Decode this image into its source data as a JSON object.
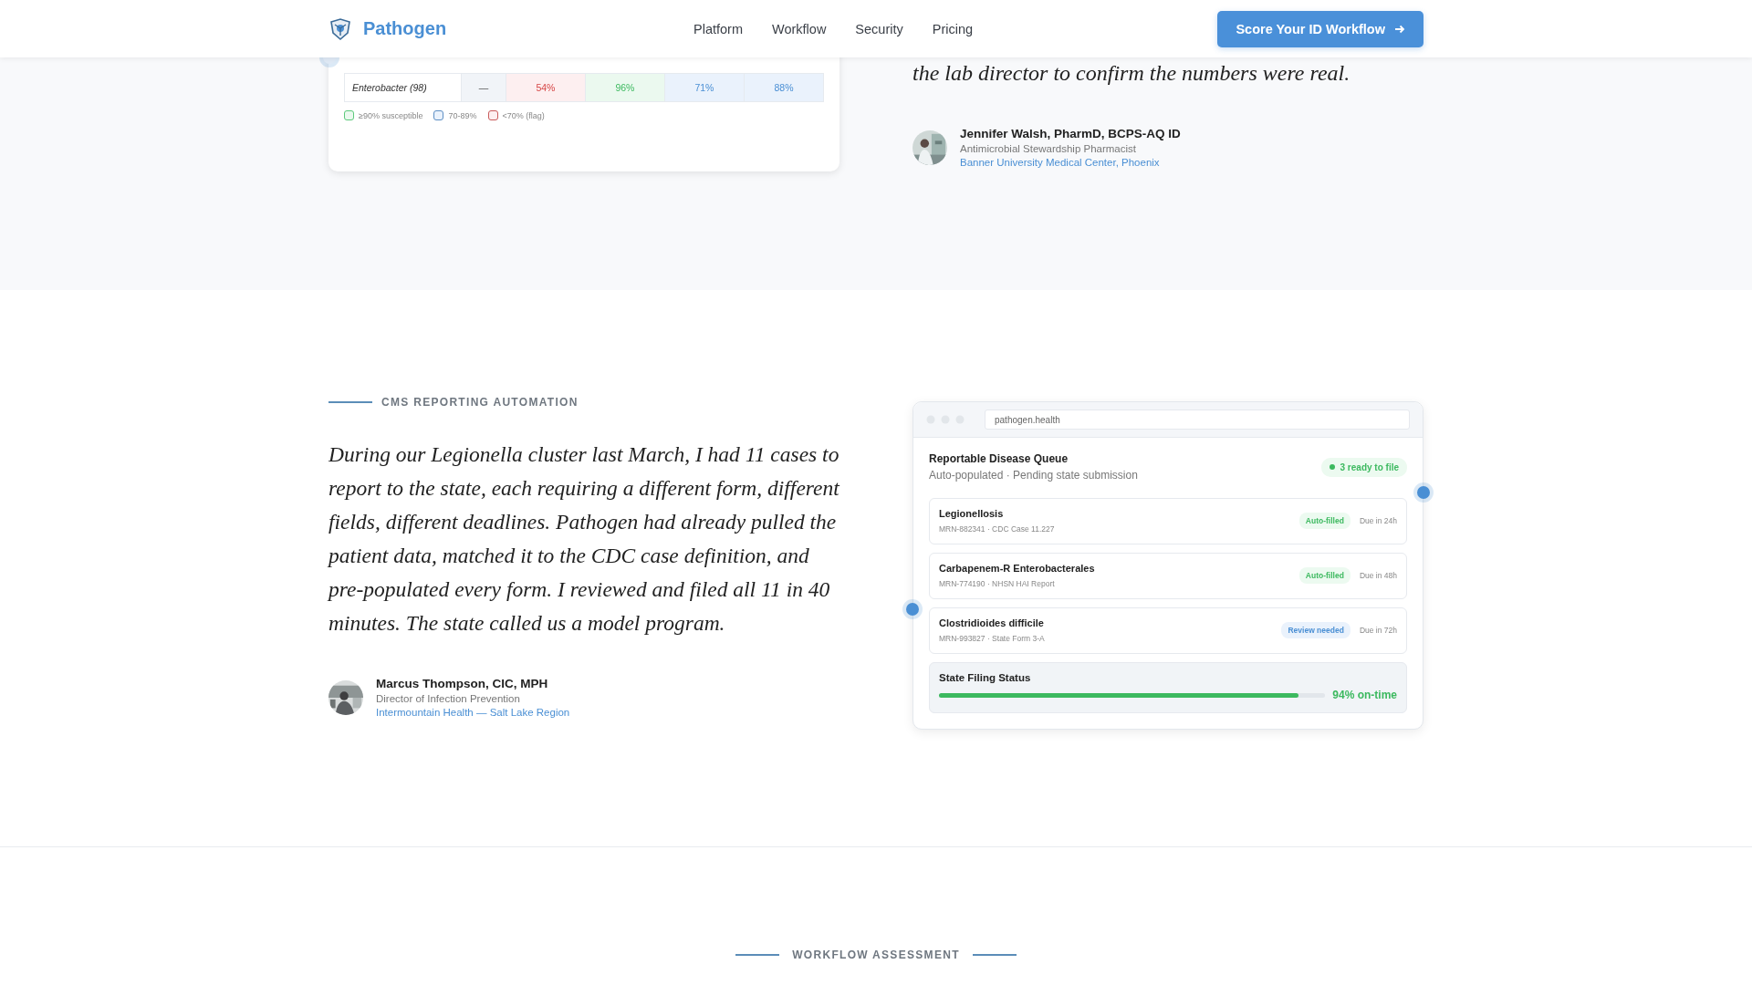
{
  "header": {
    "brand": "Pathogen",
    "nav": [
      "Platform",
      "Workflow",
      "Security",
      "Pricing"
    ],
    "cta": "Score Your ID Workflow"
  },
  "susceptibility": {
    "rows": [
      {
        "organism": "Enterobacter (98)",
        "cells": [
          {
            "value": "—",
            "kind": "none"
          },
          {
            "value": "54%",
            "kind": "low"
          },
          {
            "value": "96%",
            "kind": "high"
          },
          {
            "value": "71%",
            "kind": "mid"
          },
          {
            "value": "88%",
            "kind": "mid"
          }
        ]
      }
    ],
    "legend": [
      {
        "label": "≥90% susceptible",
        "kind": "high"
      },
      {
        "label": "70-89%",
        "kind": "mid"
      },
      {
        "label": "<70% (flag)",
        "kind": "low"
      }
    ]
  },
  "testimonial_1": {
    "quote_end": "the lab director to confirm the numbers were real.",
    "name": "Jennifer Walsh, PharmD, BCPS-AQ ID",
    "role": "Antimicrobial Stewardship Pharmacist",
    "org": "Banner University Medical Center, Phoenix"
  },
  "testimonial_2": {
    "eyebrow": "CMS REPORTING AUTOMATION",
    "quote": "During our Legionella cluster last March, I had 11 cases to report to the state, each requiring a different form, different fields, different deadlines. Pathogen had already pulled the patient data, matched it to the CDC case definition, and pre-populated every form. I reviewed and filed all 11 in 40 minutes. The state called us a model program.",
    "name": "Marcus Thompson, CIC, MPH",
    "role": "Director of Infection Prevention",
    "org": "Intermountain Health — Salt Lake Region"
  },
  "queue_window": {
    "url": "pathogen.health",
    "title": "Reportable Disease Queue",
    "subtitle": "Auto-populated · Pending state submission",
    "ready_badge": "3 ready to file",
    "items": [
      {
        "name": "Legionellosis",
        "meta": "MRN-882341 · CDC Case 11.227",
        "status": "Auto-filled",
        "kind": "auto",
        "due": "Due in 24h"
      },
      {
        "name": "Carbapenem-R Enterobacterales",
        "meta": "MRN-774190 · NHSN HAI Report",
        "status": "Auto-filled",
        "kind": "auto",
        "due": "Due in 48h"
      },
      {
        "name": "Clostridioides difficile",
        "meta": "MRN-993827 · State Form 3-A",
        "status": "Review needed",
        "kind": "review",
        "due": "Due in 72h"
      }
    ],
    "filing": {
      "label": "State Filing Status",
      "level": 0.93,
      "reading": "94% on-time"
    }
  },
  "next_section": {
    "eyebrow": "WORKFLOW ASSESSMENT"
  }
}
